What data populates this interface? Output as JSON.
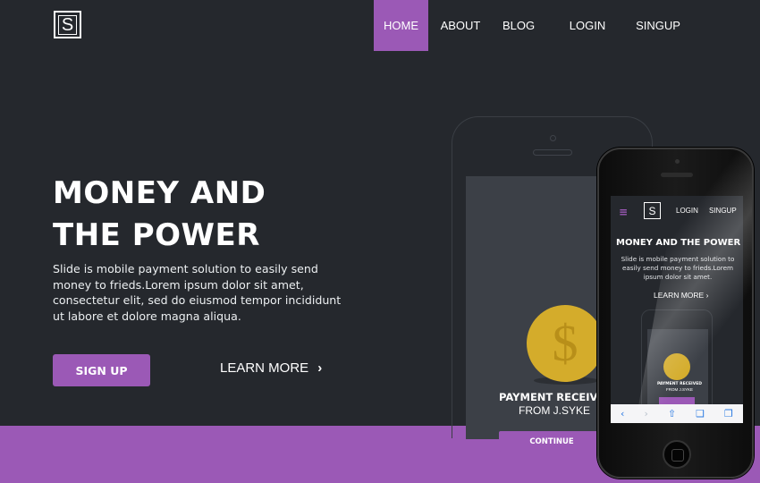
{
  "logo": {
    "letter": "S"
  },
  "nav": {
    "home": "HOME",
    "about": "ABOUT",
    "blog": "BLOG",
    "login": "LOGIN",
    "signup": "SINGUP"
  },
  "hero": {
    "title": "MONEY AND THE POWER",
    "text": "Slide is mobile payment solution to easily send money to frieds.Lorem ipsum dolor sit amet, consectetur elit, sed do eiusmod tempor incididunt ut labore et dolore magna aliqua.",
    "signup_button": "SIGN UP",
    "learn_more": "LEARN MORE",
    "learn_more_chevron": "›"
  },
  "phone_outline": {
    "coin_symbol": "$",
    "payment_title": "PAYMENT RECEIVED",
    "payment_from": "FROM J.SYKE",
    "continue_button": "CONTINUE"
  },
  "iphone_screen": {
    "menu_icon": "≡",
    "logo_letter": "S",
    "login": "LOGIN",
    "signup": "SINGUP",
    "title": "MONEY AND THE POWER",
    "text": "Slide is mobile payment solution to easily send money to frieds.Lorem ipsum dolor sit amet.",
    "learn_more": "LEARN MORE ›",
    "payment_title": "PAYMENT RECEIVED",
    "payment_from": "FROM J.SYKE",
    "toolbar": {
      "back": "‹",
      "forward": "›",
      "share": "⇧",
      "bookmarks": "❑",
      "tabs": "❐"
    }
  },
  "colors": {
    "background": "#25282d",
    "accent": "#9b59b6",
    "coin": "#d4ac2b"
  }
}
